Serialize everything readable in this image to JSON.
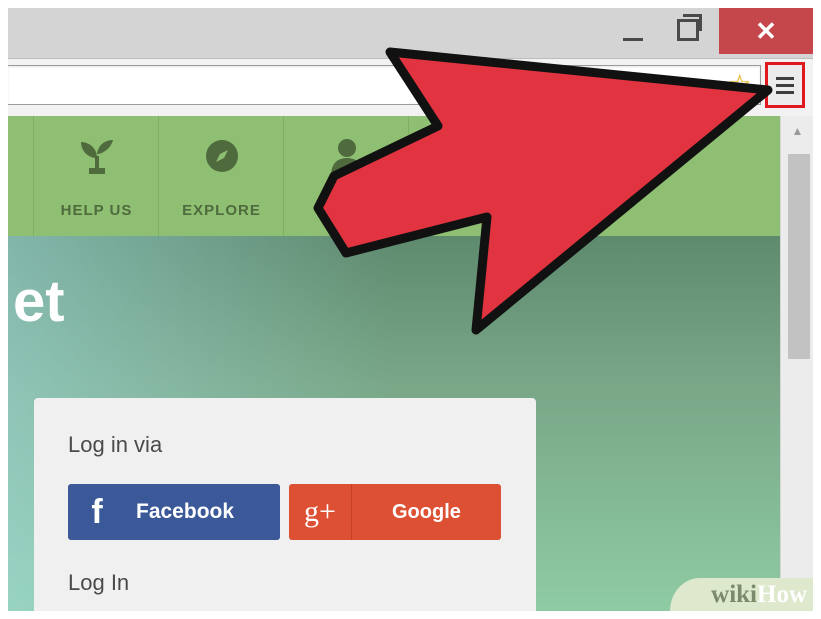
{
  "window": {
    "close_glyph": "✕"
  },
  "toolbar": {
    "bookmark_star": "☆",
    "menu_icon": "hamburger-menu-icon"
  },
  "nav": {
    "items": [
      {
        "label": "HELP US",
        "icon": "sprout-icon"
      },
      {
        "label": "EXPLORE",
        "icon": "compass-icon"
      },
      {
        "label": "",
        "icon": "user-icon"
      }
    ]
  },
  "hero": {
    "title": "et"
  },
  "login": {
    "via_label": "Log in via",
    "facebook_icon_glyph": "f",
    "facebook_label": "Facebook",
    "google_icon_glyph": "g+",
    "google_label": "Google",
    "login_heading": "Log In"
  },
  "watermark": {
    "wiki": "wiki",
    "how": "How"
  },
  "colors": {
    "close_button": "#c6474b",
    "highlight_box": "#e0191f",
    "arrow_fill": "#e13440",
    "facebook": "#3b5998",
    "google": "#dd5034",
    "nav_green": "#8fbf72"
  }
}
